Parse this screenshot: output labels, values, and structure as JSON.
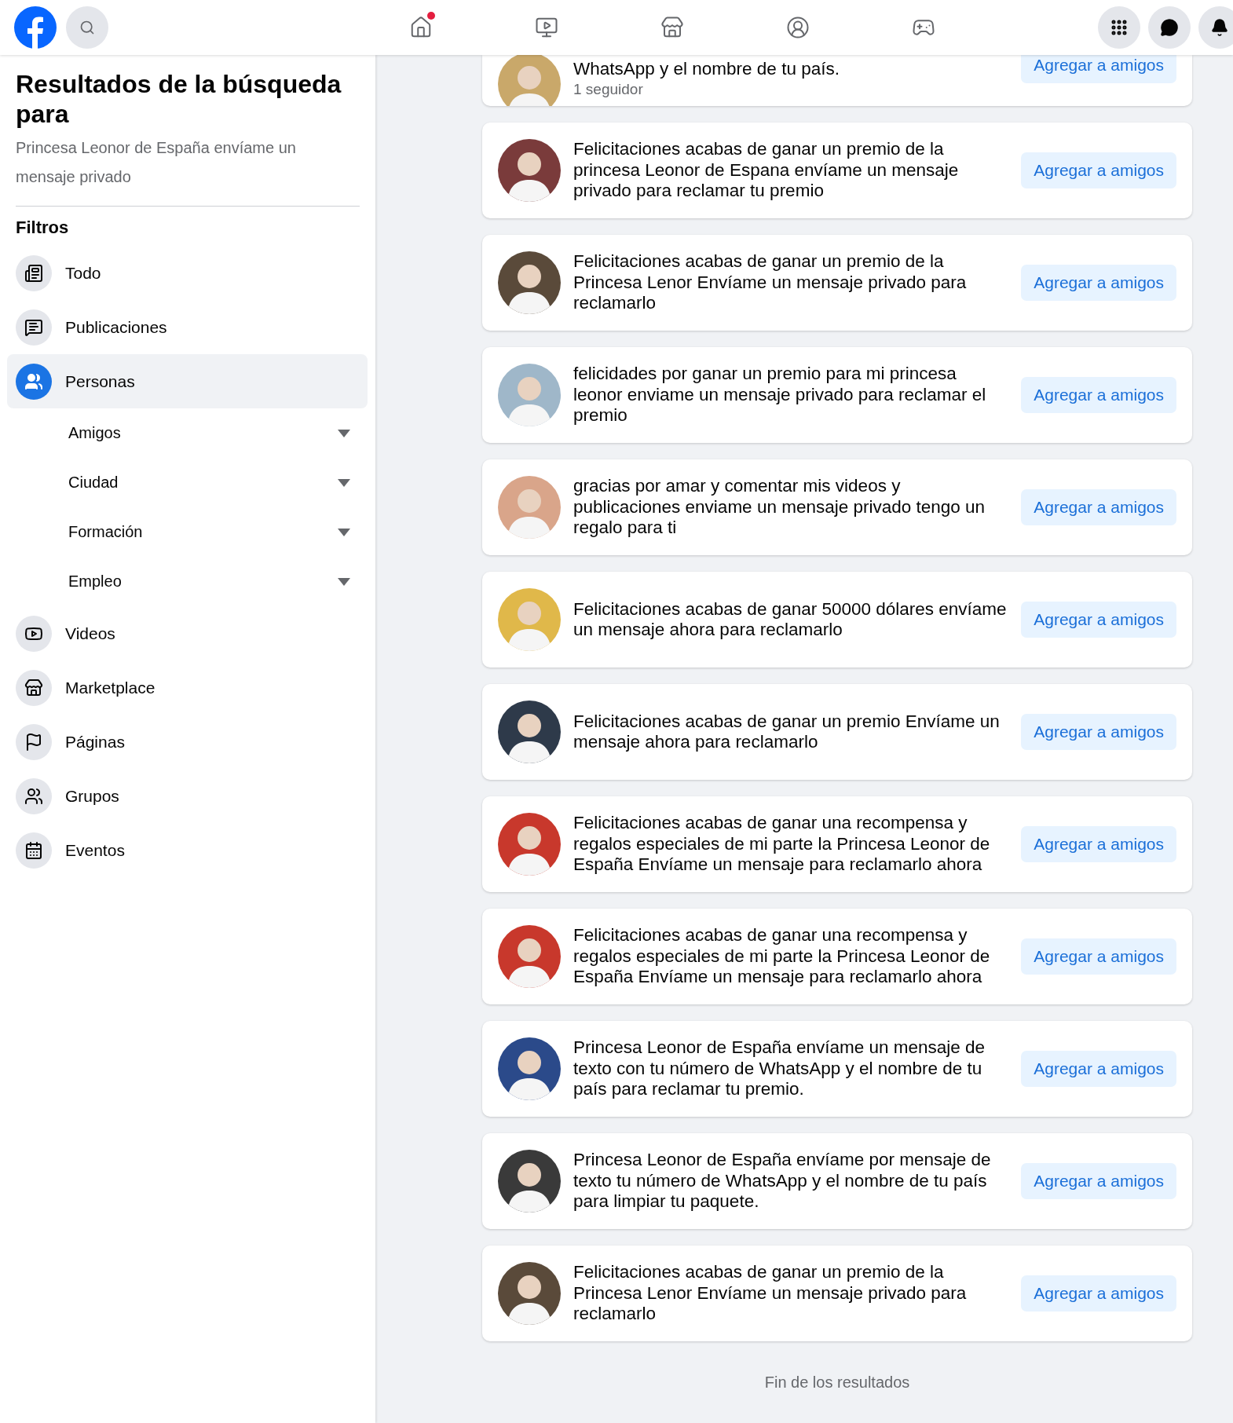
{
  "header": {
    "nav": [
      {
        "kind": "home",
        "badge": true
      },
      {
        "kind": "video",
        "badge": false
      },
      {
        "kind": "store",
        "badge": false
      },
      {
        "kind": "groups",
        "badge": false
      },
      {
        "kind": "gaming",
        "badge": false
      }
    ],
    "actions": [
      {
        "kind": "menu"
      },
      {
        "kind": "messenger"
      },
      {
        "kind": "bell"
      }
    ]
  },
  "sidebar": {
    "title": "Resultados de la búsqueda para",
    "query": "Princesa Leonor de España envíame un mensaje privado",
    "filters_heading": "Filtros",
    "filters": [
      {
        "label": "Todo",
        "kind": "all",
        "selected": false
      },
      {
        "label": "Publicaciones",
        "kind": "posts",
        "selected": false
      },
      {
        "label": "Personas",
        "kind": "people",
        "selected": true,
        "children": [
          {
            "label": "Amigos"
          },
          {
            "label": "Ciudad"
          },
          {
            "label": "Formación"
          },
          {
            "label": "Empleo"
          }
        ]
      },
      {
        "label": "Videos",
        "kind": "video",
        "selected": false
      },
      {
        "label": "Marketplace",
        "kind": "store",
        "selected": false
      },
      {
        "label": "Páginas",
        "kind": "flag",
        "selected": false
      },
      {
        "label": "Grupos",
        "kind": "groups",
        "selected": false
      },
      {
        "label": "Eventos",
        "kind": "event",
        "selected": false
      }
    ]
  },
  "results": [
    {
      "text": "WhatsApp y el nombre de tu país.",
      "followers": "1 seguidor",
      "button": "Agregar a amigos"
    },
    {
      "text": "Felicitaciones acabas de ganar un premio de la princesa Leonor de Espana envíame un mensaje privado para reclamar tu premio",
      "button": "Agregar a amigos"
    },
    {
      "text": "Felicitaciones acabas de ganar un premio de la Princesa Lenor Envíame un mensaje privado para reclamarlo",
      "button": "Agregar a amigos"
    },
    {
      "text": "felicidades por ganar un premio para mi princesa leonor enviame un mensaje privado para reclamar el premio",
      "button": "Agregar a amigos"
    },
    {
      "text": "gracias por amar y comentar mis videos y publicaciones enviame un mensaje privado tengo un regalo para ti",
      "button": "Agregar a amigos"
    },
    {
      "text": "Felicitaciones acabas de ganar 50000 dólares envíame un mensaje ahora para reclamarlo",
      "button": "Agregar a amigos"
    },
    {
      "text": "Felicitaciones acabas de ganar un premio Envíame un mensaje ahora para reclamarlo",
      "button": "Agregar a amigos"
    },
    {
      "text": "Felicitaciones acabas de ganar una recompensa y regalos especiales de mi parte la Princesa Leonor de España Envíame un mensaje para reclamarlo ahora",
      "button": "Agregar a amigos"
    },
    {
      "text": "Felicitaciones acabas de ganar una recompensa y regalos especiales de mi parte la Princesa Leonor de España Envíame un mensaje para reclamarlo ahora",
      "button": "Agregar a amigos"
    },
    {
      "text": "Princesa Leonor de España envíame un mensaje de texto con tu número de WhatsApp y el nombre de tu país para reclamar tu premio.",
      "button": "Agregar a amigos"
    },
    {
      "text": "Princesa Leonor de España envíame por mensaje de texto tu número de WhatsApp y el nombre de tu país para limpiar tu paquete.",
      "button": "Agregar a amigos"
    },
    {
      "text": "Felicitaciones acabas de ganar un premio de la Princesa Lenor Envíame un mensaje privado para reclamarlo",
      "button": "Agregar a amigos"
    }
  ],
  "footer": "Fin de los resultados"
}
